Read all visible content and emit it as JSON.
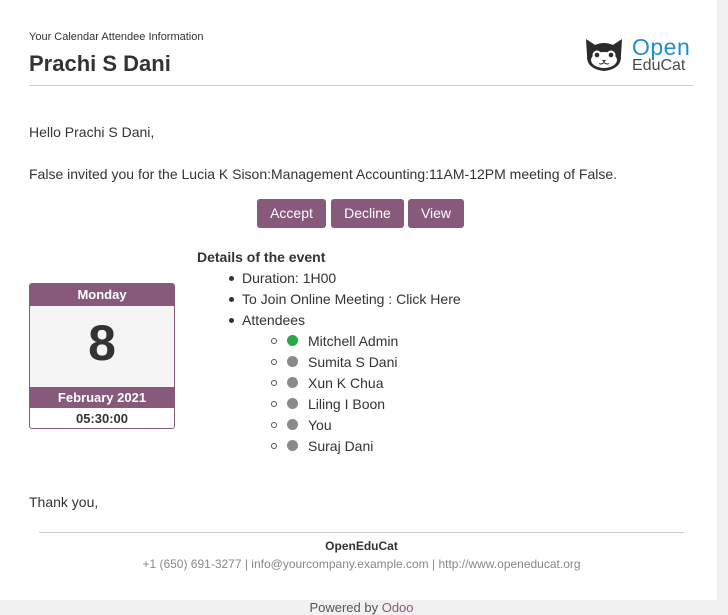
{
  "header": {
    "eyebrow": "Your Calendar Attendee Information",
    "attendee_name": "Prachi S Dani"
  },
  "logo": {
    "icon": "cat-face-icon",
    "word_open": "Open",
    "word_educat": "EduCat",
    "colors": {
      "open": "#1f8fce",
      "educat": "#4a4a4a"
    }
  },
  "body": {
    "greeting": "Hello Prachi S Dani,",
    "invitation": "False invited you for the Lucia K Sison:Management Accounting:11AM-12PM meeting of False."
  },
  "actions": {
    "accept": "Accept",
    "decline": "Decline",
    "view": "View"
  },
  "calendar": {
    "weekday": "Monday",
    "day": "8",
    "month_year": "February 2021",
    "time": "05:30:00"
  },
  "details": {
    "title": "Details of the event",
    "duration": "Duration: 1H00",
    "join": "To Join Online Meeting : Click Here",
    "attendees_label": "Attendees",
    "attendees": [
      {
        "name": "Mitchell Admin",
        "status": "accepted",
        "color": "#28a745"
      },
      {
        "name": "Sumita S Dani",
        "status": "needs-action",
        "color": "#8a8a8a"
      },
      {
        "name": "Xun K Chua",
        "status": "needs-action",
        "color": "#8a8a8a"
      },
      {
        "name": "Liling I Boon",
        "status": "needs-action",
        "color": "#8a8a8a"
      },
      {
        "name": "You",
        "status": "needs-action",
        "color": "#8a8a8a"
      },
      {
        "name": "Suraj Dani",
        "status": "needs-action",
        "color": "#8a8a8a"
      }
    ]
  },
  "closing": "Thank you,",
  "footer": {
    "company": "OpenEduCat",
    "contact": "+1 (650) 691-3277 | info@yourcompany.example.com | http://www.openeducat.org",
    "powered_prefix": "Powered by ",
    "powered_brand": "Odoo"
  },
  "theme": {
    "accent": "#875a7b",
    "background": "#f1f1f1"
  }
}
